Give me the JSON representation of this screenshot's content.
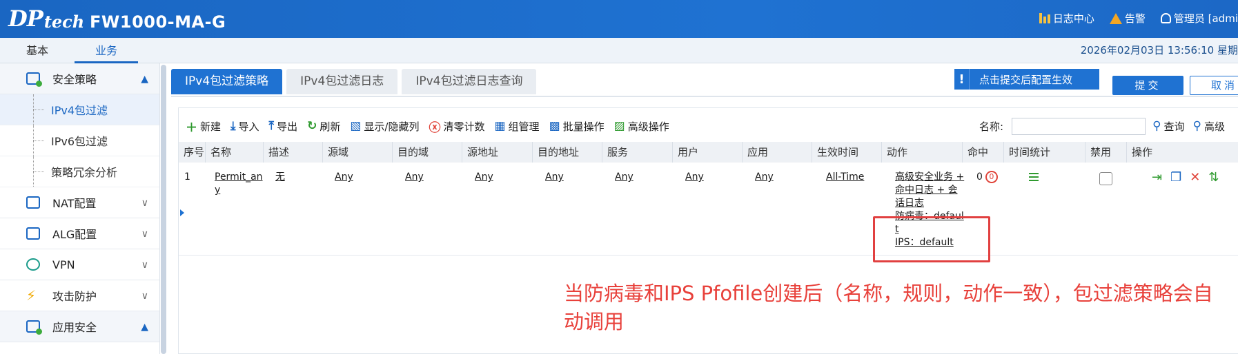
{
  "header": {
    "logo_dp": "DP",
    "logo_tech": "tech",
    "model": "FW1000-MA-G",
    "log_center": "日志中心",
    "alarm": "告警",
    "admin": "管理员 [admi"
  },
  "nav": {
    "tabs": [
      "基本",
      "业务"
    ],
    "datetime": "2026年02月03日   13:56:10   星期"
  },
  "sidebar": {
    "security_policy": "安全策略",
    "sub_items": [
      "IPv4包过滤",
      "IPv6包过滤",
      "策略冗余分析"
    ],
    "nat": "NAT配置",
    "alg": "ALG配置",
    "vpn": "VPN",
    "attack": "攻击防护",
    "appsec": "应用安全"
  },
  "tabs": [
    "IPv4包过滤策略",
    "IPv4包过滤日志",
    "IPv4包过滤日志查询"
  ],
  "notice": {
    "mark": "!",
    "text": "点击提交后配置生效"
  },
  "buttons": {
    "submit": "提交",
    "cancel": "取消"
  },
  "toolbar": {
    "new": "新建",
    "import": "导入",
    "export": "导出",
    "refresh": "刷新",
    "show_hide": "显示/隐藏列",
    "clear_count": "清零计数",
    "group_mgmt": "组管理",
    "batch": "批量操作",
    "advanced": "高级操作"
  },
  "search": {
    "label": "名称:",
    "value": "",
    "query": "查询",
    "advanced": "高级"
  },
  "table": {
    "columns": [
      "序号",
      "名称",
      "描述",
      "源域",
      "目的域",
      "源地址",
      "目的地址",
      "服务",
      "用户",
      "应用",
      "生效时间",
      "动作",
      "命中",
      "时间统计",
      "禁用",
      "操作"
    ],
    "row": {
      "index": "1",
      "name_l1": "Permit_an",
      "name_l2": "y",
      "desc": "无",
      "src_zone": "Any",
      "dst_zone": "Any",
      "src_addr": "Any",
      "dst_addr": "Any",
      "service": "Any",
      "user": "Any",
      "app": "Any",
      "time": "All-Time",
      "action_l1": "高级安全业务 +",
      "action_l2": "命中日志 + 会",
      "action_l3": "话日志",
      "action_l4": "防病毒：defaul",
      "action_l5": "t",
      "action_l6": "IPS：default",
      "hits": "0",
      "hit_icon": "0"
    }
  },
  "annotation": "当防病毒和IPS Pfofile创建后（名称，规则，动作一致），包过滤策略会自动调用",
  "colors": {
    "primary": "#1f72d2",
    "annotation": "#e8413b"
  }
}
